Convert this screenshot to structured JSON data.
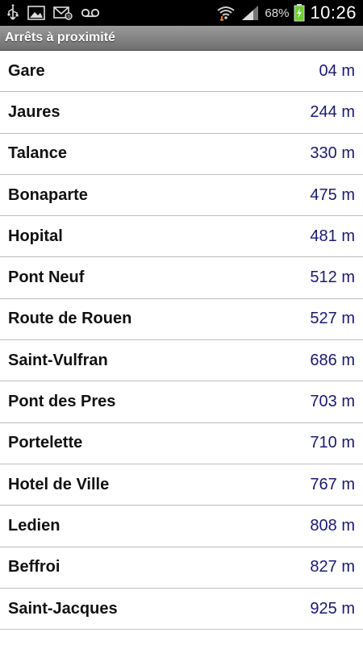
{
  "status_bar": {
    "icons_left": [
      "usb-icon",
      "picture-icon",
      "email-icon",
      "voicemail-icon"
    ],
    "icons_right": [
      "wifi-icon",
      "signal-icon"
    ],
    "battery_percent": "68%",
    "time": "10:26"
  },
  "header": {
    "title": "Arrêts à proximité"
  },
  "stops": [
    {
      "name": "Gare",
      "distance": "04 m"
    },
    {
      "name": "Jaures",
      "distance": "244 m"
    },
    {
      "name": "Talance",
      "distance": "330 m"
    },
    {
      "name": "Bonaparte",
      "distance": "475 m"
    },
    {
      "name": "Hopital",
      "distance": "481 m"
    },
    {
      "name": "Pont Neuf",
      "distance": "512 m"
    },
    {
      "name": "Route de Rouen",
      "distance": "527 m"
    },
    {
      "name": "Saint-Vulfran",
      "distance": "686 m"
    },
    {
      "name": "Pont des Pres",
      "distance": "703 m"
    },
    {
      "name": "Portelette",
      "distance": "710 m"
    },
    {
      "name": "Hotel de Ville",
      "distance": "767 m"
    },
    {
      "name": "Ledien",
      "distance": "808 m"
    },
    {
      "name": "Beffroi",
      "distance": "827 m"
    },
    {
      "name": "Saint-Jacques",
      "distance": "925 m"
    }
  ],
  "colors": {
    "distance_text": "#1a1a6e",
    "header_bg": "#8a8a8a",
    "battery_fill": "#6bd12f"
  }
}
